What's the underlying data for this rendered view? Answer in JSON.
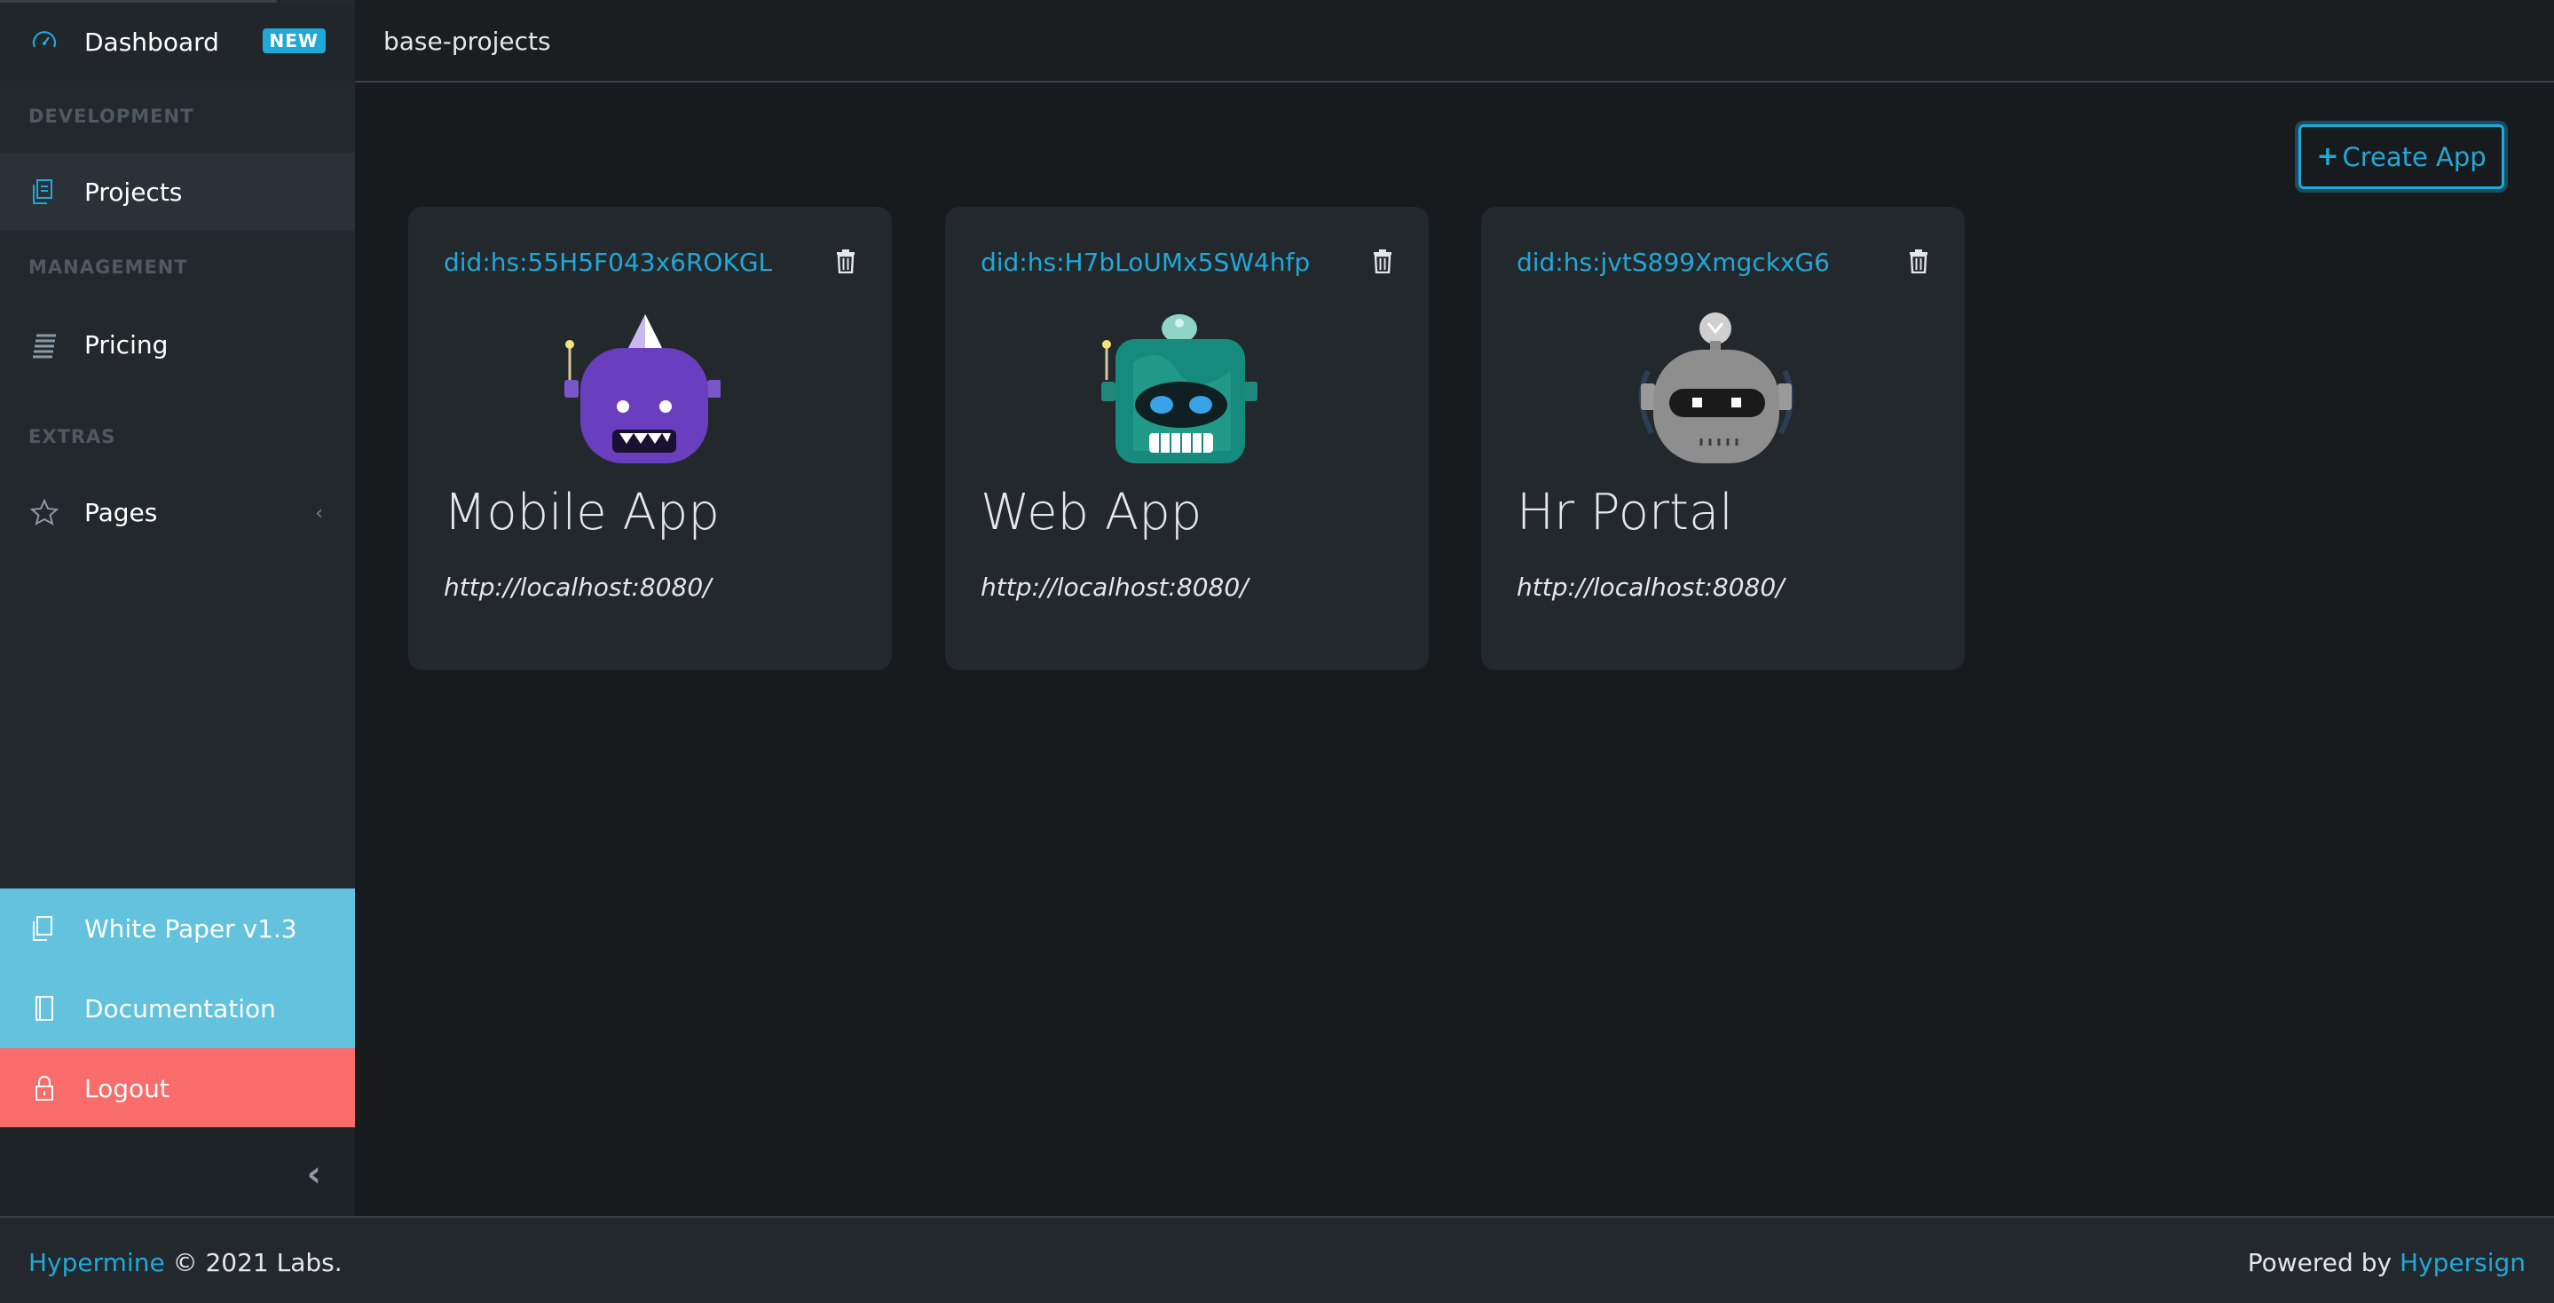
{
  "sidebar": {
    "dashboard": {
      "label": "Dashboard",
      "badge": "NEW",
      "icon": "speedometer-icon"
    },
    "sections": {
      "development": "DEVELOPMENT",
      "management": "MANAGEMENT",
      "extras": "EXTRAS"
    },
    "projects": {
      "label": "Projects",
      "icon": "docs-icon"
    },
    "pricing": {
      "label": "Pricing",
      "icon": "list-icon"
    },
    "pages": {
      "label": "Pages",
      "icon": "star-icon"
    },
    "links": {
      "whitepaper": "White Paper v1.3",
      "documentation": "Documentation",
      "logout": "Logout"
    }
  },
  "header": {
    "breadcrumb": "base-projects"
  },
  "main": {
    "create_button": "Create App",
    "cards": [
      {
        "did": "did:hs:55H5F043x6ROKGL",
        "name": "Mobile App",
        "url": "http://localhost:8080/",
        "avatar": "purple-robot"
      },
      {
        "did": "did:hs:H7bLoUMx5SW4hfp",
        "name": "Web App",
        "url": "http://localhost:8080/",
        "avatar": "teal-robot"
      },
      {
        "did": "did:hs:jvtS899XmgckxG6",
        "name": "Hr Portal",
        "url": "http://localhost:8080/",
        "avatar": "gray-robot"
      }
    ]
  },
  "footer": {
    "brand": "Hypermine",
    "copyright": "© 2021 Labs.",
    "powered_by": "Powered by",
    "powered_brand": "Hypersign"
  },
  "colors": {
    "accent": "#20a8d8",
    "info": "#63c2de",
    "danger": "#f86c6b",
    "sidebar_bg": "#23282c",
    "body_bg": "#181b1e"
  }
}
